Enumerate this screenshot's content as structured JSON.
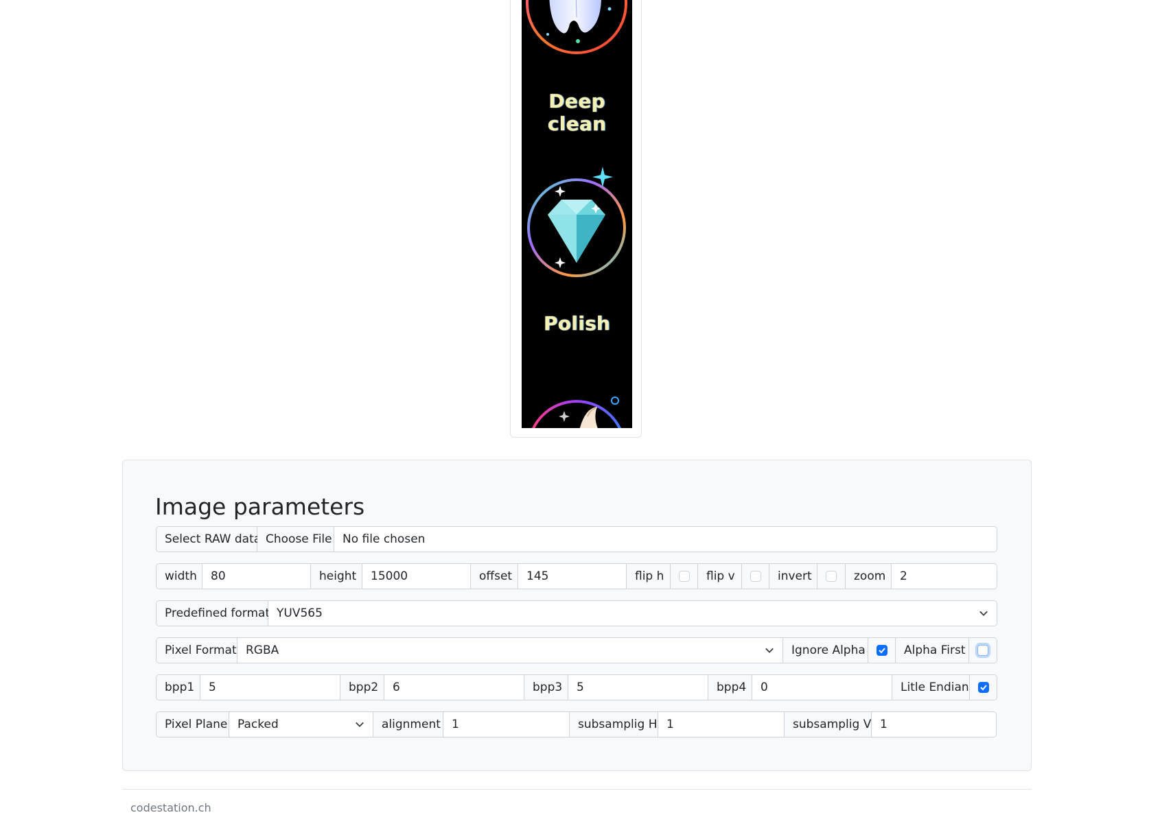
{
  "preview": {
    "captions": [
      "Deep clean",
      "Polish"
    ],
    "icons": [
      "tooth-icon",
      "diamond-icon",
      "brush-icon"
    ]
  },
  "panel": {
    "title": "Image parameters",
    "file": {
      "label": "Select RAW data",
      "button": "Choose File",
      "status": "No file chosen"
    },
    "dims": {
      "width_label": "width",
      "width_value": "80",
      "height_label": "height",
      "height_value": "15000",
      "offset_label": "offset",
      "offset_value": "145",
      "fliph_label": "flip h",
      "fliph_checked": false,
      "flipv_label": "flip v",
      "flipv_checked": false,
      "invert_label": "invert",
      "invert_checked": false,
      "zoom_label": "zoom",
      "zoom_value": "2"
    },
    "predefined": {
      "label": "Predefined format",
      "value": "YUV565"
    },
    "pixel_format": {
      "label": "Pixel Format",
      "value": "RGBA",
      "ignore_alpha_label": "Ignore Alpha",
      "ignore_alpha_checked": true,
      "alpha_first_label": "Alpha First",
      "alpha_first_checked": false
    },
    "bpp": {
      "bpp1_label": "bpp1",
      "bpp1_value": "5",
      "bpp2_label": "bpp2",
      "bpp2_value": "6",
      "bpp3_label": "bpp3",
      "bpp3_value": "5",
      "bpp4_label": "bpp4",
      "bpp4_value": "0",
      "endian_label": "Litle Endian",
      "endian_checked": true
    },
    "plane": {
      "label": "Pixel Plane",
      "value": "Packed",
      "alignment_label": "alignment",
      "alignment_value": "1",
      "subh_label": "subsamplig H",
      "subh_value": "1",
      "subv_label": "subsamplig V",
      "subv_value": "1"
    }
  },
  "footer": {
    "text": "codestation.ch"
  },
  "colors": {
    "accent": "#0d6efd",
    "border": "#ced4da",
    "panel_bg": "#f8f9fa"
  }
}
